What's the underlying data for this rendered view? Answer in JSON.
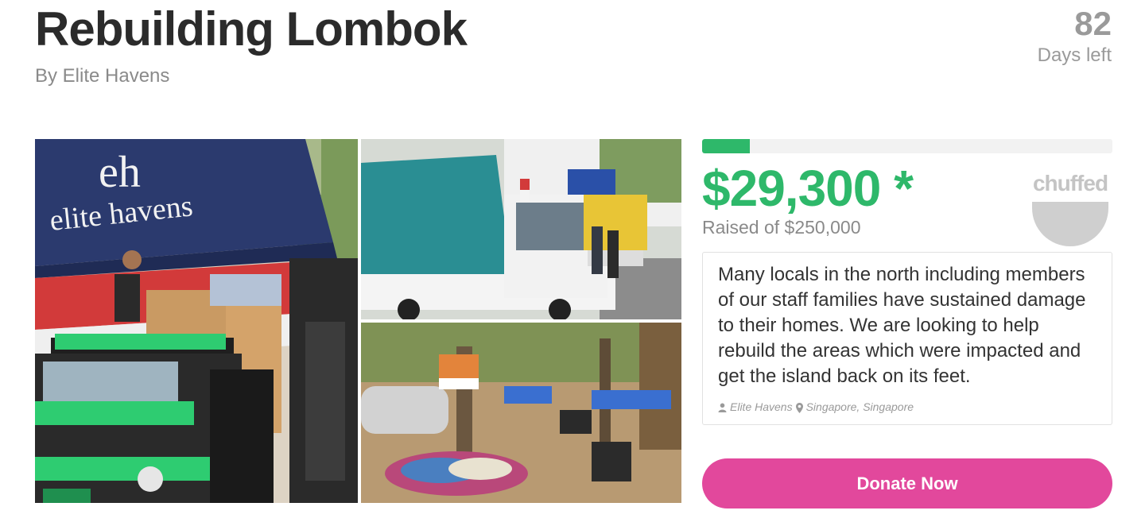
{
  "campaign": {
    "title": "Rebuilding Lombok",
    "byline": "By Elite Havens",
    "days_left_number": "82",
    "days_left_label": "Days left"
  },
  "funding": {
    "amount": "$29,300 *",
    "raised_of": "Raised of $250,000",
    "progress_fraction": 0.117,
    "accent_color": "#2eb86a"
  },
  "badge": {
    "word": "chuffed"
  },
  "description": {
    "text": "Many locals in the north including members of our staff families have sustained damage to their homes. We are looking to help rebuild the areas which were impacted and get the island back on its feet.",
    "organizer": "Elite Havens",
    "location": "Singapore, Singapore",
    "organizer_icon": "user-icon",
    "location_icon": "map-marker-icon"
  },
  "photo": {
    "tent_text_top": "eh",
    "tent_text_bottom": "elite havens"
  },
  "actions": {
    "donate_label": "Donate Now",
    "donate_color": "#e2489c"
  }
}
